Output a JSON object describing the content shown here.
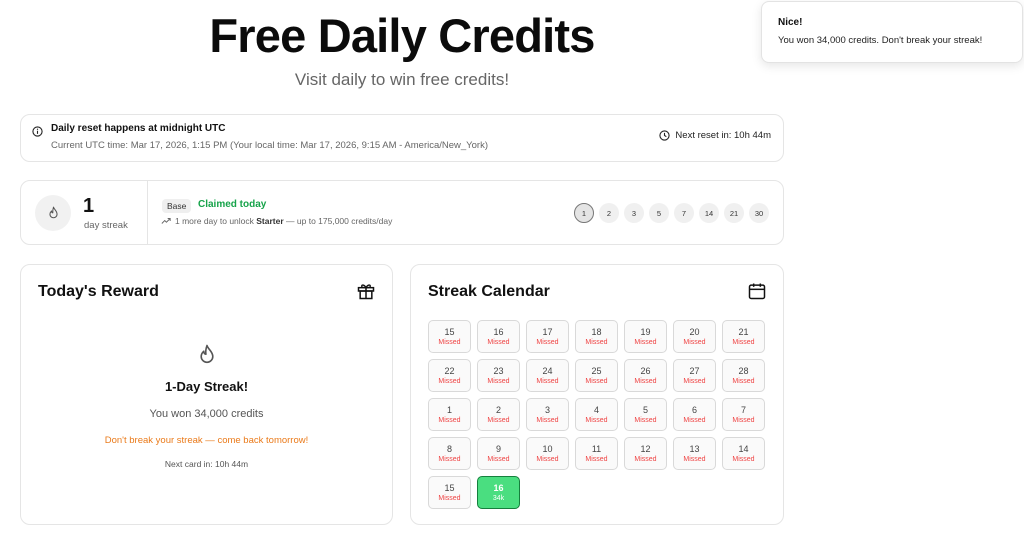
{
  "header": {
    "title": "Free Daily Credits",
    "subtitle": "Visit daily to win free credits!"
  },
  "toast": {
    "title": "Nice!",
    "message": "You won 34,000 credits. Don't break your streak!"
  },
  "reset": {
    "title": "Daily reset happens at midnight UTC",
    "times": "Current UTC time: Mar 17, 2026, 1:15 PM  (Your local time: Mar 17, 2026, 9:15 AM - America/New_York)",
    "next_reset": "Next reset in: 10h 44m"
  },
  "streak": {
    "count": "1",
    "label": "day streak",
    "tier": "Base",
    "status": "Claimed today",
    "unlock_prefix": "1 more day to unlock ",
    "unlock_tier": "Starter",
    "unlock_suffix": " — up to 175,000 credits/day",
    "milestones": [
      "1",
      "2",
      "3",
      "5",
      "7",
      "14",
      "21",
      "30"
    ],
    "active_milestone": "1"
  },
  "reward": {
    "title": "Today's Reward",
    "headline": "1-Day Streak!",
    "won": "You won 34,000 credits",
    "warning": "Don't break your streak — come back tomorrow!",
    "next_card": "Next card in: 10h 44m"
  },
  "calendar": {
    "title": "Streak Calendar",
    "days": [
      {
        "day": "15",
        "status": "Missed"
      },
      {
        "day": "16",
        "status": "Missed"
      },
      {
        "day": "17",
        "status": "Missed"
      },
      {
        "day": "18",
        "status": "Missed"
      },
      {
        "day": "19",
        "status": "Missed"
      },
      {
        "day": "20",
        "status": "Missed"
      },
      {
        "day": "21",
        "status": "Missed"
      },
      {
        "day": "22",
        "status": "Missed"
      },
      {
        "day": "23",
        "status": "Missed"
      },
      {
        "day": "24",
        "status": "Missed"
      },
      {
        "day": "25",
        "status": "Missed"
      },
      {
        "day": "26",
        "status": "Missed"
      },
      {
        "day": "27",
        "status": "Missed"
      },
      {
        "day": "28",
        "status": "Missed"
      },
      {
        "day": "1",
        "status": "Missed"
      },
      {
        "day": "2",
        "status": "Missed"
      },
      {
        "day": "3",
        "status": "Missed"
      },
      {
        "day": "4",
        "status": "Missed"
      },
      {
        "day": "5",
        "status": "Missed"
      },
      {
        "day": "6",
        "status": "Missed"
      },
      {
        "day": "7",
        "status": "Missed"
      },
      {
        "day": "8",
        "status": "Missed"
      },
      {
        "day": "9",
        "status": "Missed"
      },
      {
        "day": "10",
        "status": "Missed"
      },
      {
        "day": "11",
        "status": "Missed"
      },
      {
        "day": "12",
        "status": "Missed"
      },
      {
        "day": "13",
        "status": "Missed"
      },
      {
        "day": "14",
        "status": "Missed"
      },
      {
        "day": "15",
        "status": "Missed"
      },
      {
        "day": "16",
        "status": "34k",
        "claimed": true
      }
    ]
  },
  "colors": {
    "claimed_green": "#16a34a",
    "missed_red": "#ef4444",
    "warning_orange": "#ea7a1a",
    "calendar_claimed_fill": "#4ade80"
  }
}
